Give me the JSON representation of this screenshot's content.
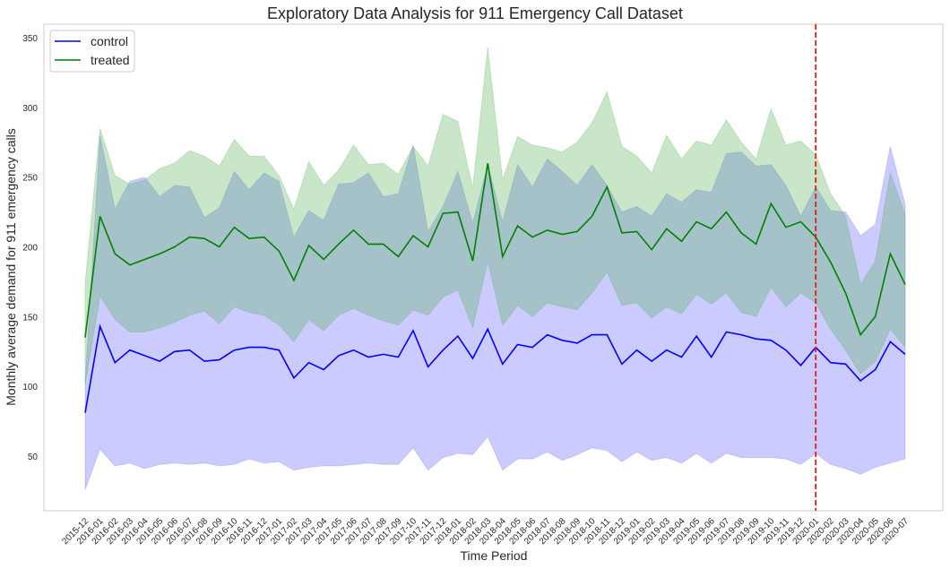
{
  "chart_data": {
    "type": "line",
    "title": "Exploratory Data Analysis for 911 Emergency Call Dataset",
    "xlabel": "Time Period",
    "ylabel": "Monthly average demand for 911 emergency calls",
    "ylim": [
      10,
      359
    ],
    "yticks": [
      50,
      100,
      150,
      200,
      250,
      300,
      350
    ],
    "grid": false,
    "legend_position": "top-left",
    "x": [
      "2015-12",
      "2016-01",
      "2016-02",
      "2016-03",
      "2016-04",
      "2016-05",
      "2016-06",
      "2016-07",
      "2016-08",
      "2016-09",
      "2016-10",
      "2016-11",
      "2016-12",
      "2017-01",
      "2017-02",
      "2017-03",
      "2017-04",
      "2017-05",
      "2017-06",
      "2017-07",
      "2017-08",
      "2017-09",
      "2017-10",
      "2017-11",
      "2017-12",
      "2018-01",
      "2018-02",
      "2018-03",
      "2018-04",
      "2018-05",
      "2018-06",
      "2018-07",
      "2018-08",
      "2018-09",
      "2018-10",
      "2018-11",
      "2018-12",
      "2019-01",
      "2019-02",
      "2019-03",
      "2019-04",
      "2019-05",
      "2019-06",
      "2019-07",
      "2019-08",
      "2019-09",
      "2019-10",
      "2019-11",
      "2019-12",
      "2020-01",
      "2020-02",
      "2020-03",
      "2020-04",
      "2020-05",
      "2020-06",
      "2020-07"
    ],
    "series": [
      {
        "name": "control",
        "color": "#0000ff",
        "band_color": "#6666ff",
        "values": [
          81,
          143,
          117,
          126,
          122,
          118,
          125,
          126,
          118,
          119,
          126,
          128,
          128,
          126,
          106,
          117,
          112,
          122,
          126,
          121,
          123,
          121,
          140,
          114,
          126,
          136,
          120,
          141,
          116,
          130,
          128,
          137,
          133,
          131,
          137,
          137,
          116,
          126,
          118,
          126,
          121,
          136,
          121,
          139,
          137,
          134,
          133,
          126,
          115,
          128,
          117,
          116,
          104,
          112,
          132,
          123
        ],
        "upper": [
          103,
          280,
          227,
          247,
          250,
          236,
          244,
          243,
          221,
          228,
          254,
          241,
          253,
          247,
          207,
          226,
          219,
          245,
          246,
          253,
          236,
          238,
          273,
          211,
          229,
          254,
          217,
          259,
          218,
          259,
          243,
          263,
          254,
          244,
          259,
          244,
          225,
          229,
          222,
          238,
          232,
          241,
          239,
          267,
          268,
          258,
          259,
          244,
          222,
          243,
          226,
          225,
          208,
          216,
          272,
          230
        ],
        "lower": [
          26,
          55,
          43,
          45,
          41,
          44,
          45,
          44,
          45,
          43,
          44,
          48,
          45,
          46,
          40,
          42,
          43,
          43,
          44,
          45,
          44,
          44,
          56,
          40,
          49,
          52,
          51,
          64,
          40,
          48,
          48,
          53,
          47,
          51,
          56,
          54,
          46,
          53,
          47,
          49,
          45,
          52,
          45,
          52,
          49,
          49,
          49,
          48,
          44,
          52,
          44,
          41,
          37,
          42,
          45,
          48
        ]
      },
      {
        "name": "treated",
        "color": "#008000",
        "band_color": "#4daf4a",
        "values": [
          135,
          222,
          195,
          187,
          191,
          195,
          200,
          207,
          206,
          200,
          214,
          206,
          207,
          197,
          176,
          201,
          191,
          202,
          212,
          202,
          202,
          193,
          208,
          200,
          224,
          225,
          190,
          260,
          193,
          215,
          207,
          212,
          209,
          211,
          222,
          243,
          210,
          211,
          198,
          213,
          204,
          218,
          213,
          225,
          210,
          202,
          231,
          214,
          218,
          207,
          189,
          167,
          137,
          150,
          195,
          173
        ],
        "upper": [
          174,
          285,
          251,
          245,
          248,
          256,
          260,
          269,
          265,
          258,
          277,
          265,
          265,
          251,
          227,
          261,
          244,
          255,
          273,
          259,
          260,
          252,
          272,
          258,
          295,
          290,
          242,
          343,
          248,
          279,
          273,
          271,
          268,
          275,
          289,
          311,
          272,
          265,
          253,
          280,
          263,
          276,
          273,
          291,
          275,
          263,
          299,
          273,
          276,
          266,
          238,
          222,
          173,
          190,
          253,
          223
        ],
        "lower": [
          101,
          165,
          148,
          139,
          139,
          142,
          146,
          151,
          154,
          145,
          157,
          153,
          151,
          144,
          132,
          148,
          140,
          151,
          156,
          151,
          147,
          144,
          155,
          151,
          164,
          169,
          142,
          190,
          144,
          158,
          150,
          160,
          157,
          155,
          167,
          182,
          158,
          160,
          149,
          157,
          152,
          166,
          159,
          167,
          153,
          150,
          171,
          157,
          167,
          160,
          141,
          126,
          109,
          118,
          141,
          128
        ]
      }
    ],
    "annotations": [
      {
        "type": "vertical-line",
        "x": "2020-01",
        "color": "#e41a1c",
        "style": "dashed"
      }
    ]
  }
}
